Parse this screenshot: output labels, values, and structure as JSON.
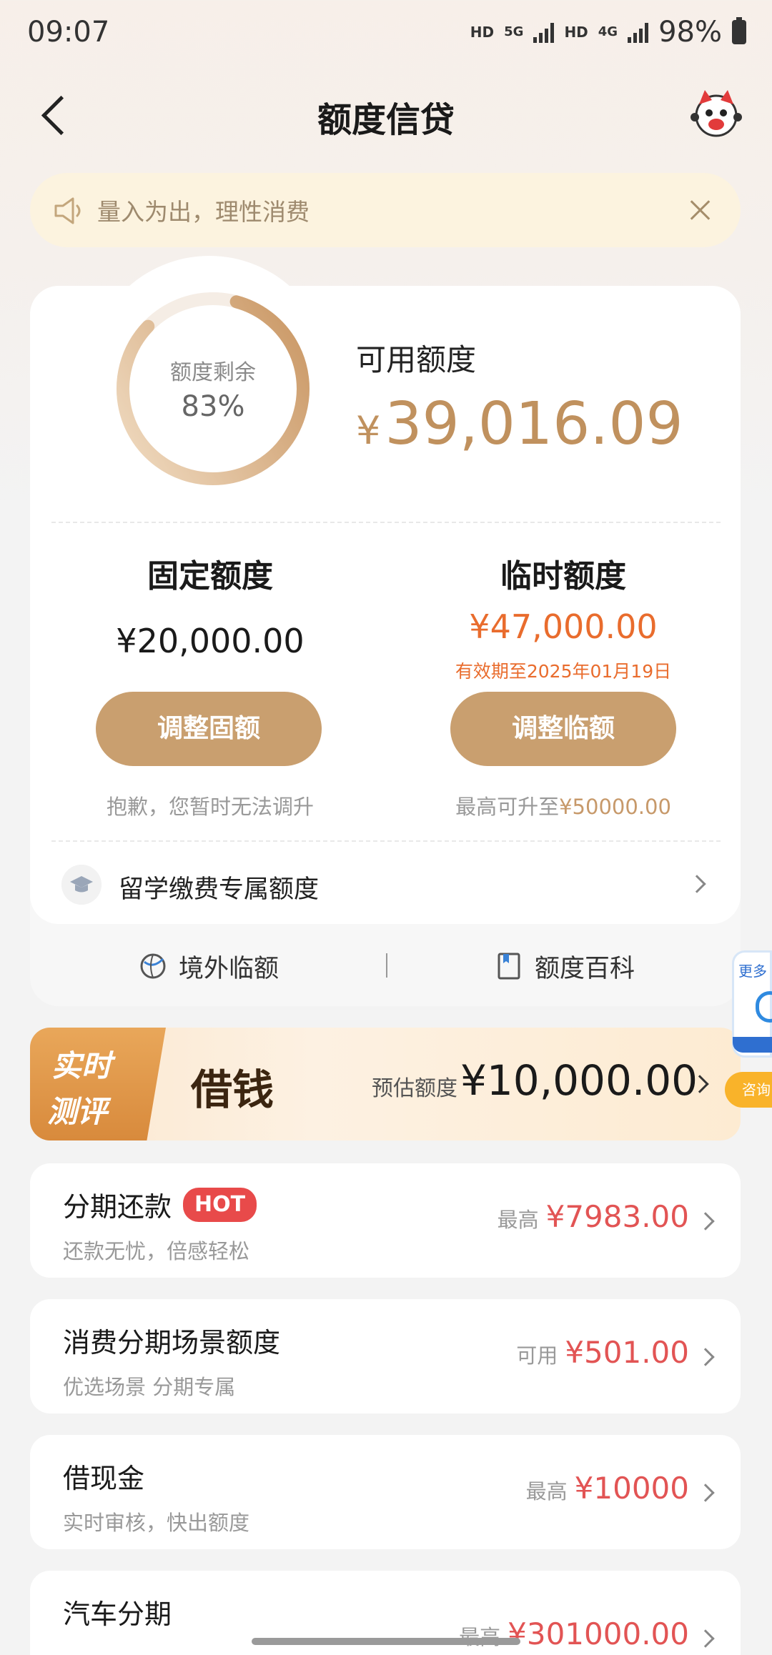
{
  "status_bar": {
    "time": "09:07",
    "hd1": "HD",
    "net1": "5G",
    "hd2": "HD",
    "net2": "4G",
    "battery": "98%"
  },
  "nav": {
    "title": "额度信贷"
  },
  "notice": {
    "text": "量入为出，理性消费"
  },
  "summary": {
    "ring_label": "额度剩余",
    "ring_percent": "83%",
    "ring_fraction": 0.83,
    "available_label": "可用额度",
    "available_currency": "¥",
    "available_value": "39,016.09"
  },
  "fixed": {
    "title": "固定额度",
    "value": "¥20,000.00",
    "button": "调整固额",
    "note": "抱歉，您暂时无法调升"
  },
  "temporary": {
    "title": "临时额度",
    "value": "¥47,000.00",
    "expiry": "有效期至2025年01月19日",
    "button": "调整临额",
    "note_prefix": "最高可升至",
    "note_value": "¥50000.00"
  },
  "study": {
    "label": "留学缴费专属额度"
  },
  "quick_links": {
    "overseas": "境外临额",
    "encyclopedia": "额度百科"
  },
  "banner": {
    "tag_line1": "实时",
    "tag_line2": "测评",
    "title": "借钱",
    "estimate_label": "预估额度",
    "amount": "¥10,000.00"
  },
  "float": {
    "more": "更多",
    "consult": "咨询"
  },
  "list": [
    {
      "title": "分期还款",
      "badge": "HOT",
      "subtitle": "还款无忧，倍感轻松",
      "prefix": "最高",
      "amount": "¥7983.00"
    },
    {
      "title": "消费分期场景额度",
      "subtitle": "优选场景 分期专属",
      "prefix": "可用",
      "amount": "¥501.00"
    },
    {
      "title": "借现金",
      "subtitle": "实时审核，快出额度",
      "prefix": "最高",
      "amount": "¥10000"
    },
    {
      "title": "汽车分期",
      "prefix": "最高",
      "amount": "¥301000.00"
    }
  ],
  "colors": {
    "accent_gold": "#c99f6f",
    "amount_red": "#e25454",
    "temp_orange": "#e96c2d"
  }
}
